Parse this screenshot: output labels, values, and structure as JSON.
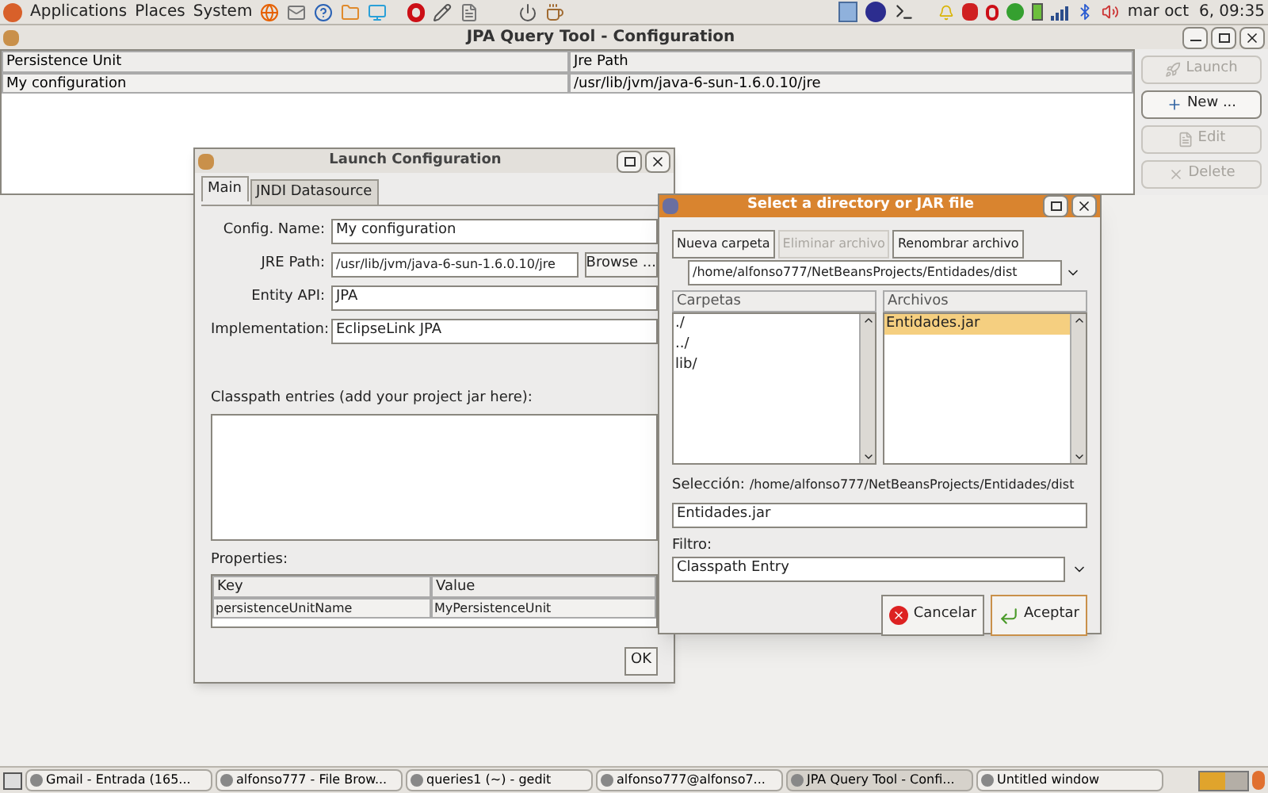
{
  "top_panel": {
    "menus": [
      "Applications",
      "Places",
      "System"
    ],
    "clock": "mar oct  6, 09:35"
  },
  "main_window": {
    "title": "JPA Query Tool - Configuration",
    "columns": [
      "Persistence Unit",
      "Jre Path"
    ],
    "rows": [
      {
        "cells": [
          "My configuration",
          "/usr/lib/jvm/java-6-sun-1.6.0.10/jre"
        ],
        "selected": false
      }
    ],
    "buttons": [
      {
        "label": "Launch",
        "disabled": true,
        "kind": "launch"
      },
      {
        "label": "New ...",
        "disabled": false,
        "kind": "new"
      },
      {
        "label": "Edit",
        "disabled": true,
        "kind": "edit"
      },
      {
        "label": "Delete",
        "disabled": true,
        "kind": "delete"
      }
    ]
  },
  "launch_dialog": {
    "title": "Launch Configuration",
    "tabs": [
      {
        "label": "Main",
        "selected": true
      },
      {
        "label": "JNDI Datasource",
        "selected": false
      }
    ],
    "fields": [
      {
        "label": "Config. Name:",
        "value": "My configuration",
        "kind": "text"
      },
      {
        "label": "JRE Path:",
        "value": "/usr/lib/jvm/java-6-sun-1.6.0.10/jre",
        "kind": "browse",
        "button": "Browse ..."
      },
      {
        "label": "Entity API:",
        "value": "JPA",
        "kind": "combo"
      },
      {
        "label": "Implementation:",
        "value": "EclipseLink JPA",
        "kind": "combo"
      }
    ],
    "classpath_label": "Classpath entries (add your project jar here):",
    "properties_label": "Properties:",
    "property_columns": [
      "Key",
      "Value"
    ],
    "properties": [
      [
        "persistenceUnitName",
        "MyPersistenceUnit"
      ]
    ],
    "ok": "OK"
  },
  "file_dialog": {
    "title": "Select a directory or JAR file",
    "buttons": [
      {
        "label": "Nueva carpeta",
        "disabled": false
      },
      {
        "label": "Eliminar archivo",
        "disabled": true
      },
      {
        "label": "Renombrar archivo",
        "disabled": false
      }
    ],
    "path": "/home/alfonso777/NetBeansProjects/Entidades/dist",
    "folders_header": "Carpetas",
    "files_header": "Archivos",
    "folders": [
      "./",
      "../",
      "lib/"
    ],
    "files": [
      {
        "name": "Entidades.jar",
        "selected": true
      }
    ],
    "selection_label": "Selección:",
    "selection_path": "/home/alfonso777/NetBeansProjects/Entidades/dist",
    "filename": "Entidades.jar",
    "filter_label": "Filtro:",
    "filter": "Classpath Entry",
    "cancel": "Cancelar",
    "accept": "Aceptar"
  },
  "taskbar": [
    {
      "label": "Gmail - Entrada (165...",
      "selected": false
    },
    {
      "label": "alfonso777 - File Brow...",
      "selected": false
    },
    {
      "label": "queries1 (~) - gedit",
      "selected": false
    },
    {
      "label": "alfonso777@alfonso7...",
      "selected": false
    },
    {
      "label": "JPA Query Tool - Confi...",
      "selected": true
    },
    {
      "label": "Untitled window",
      "selected": false
    }
  ]
}
